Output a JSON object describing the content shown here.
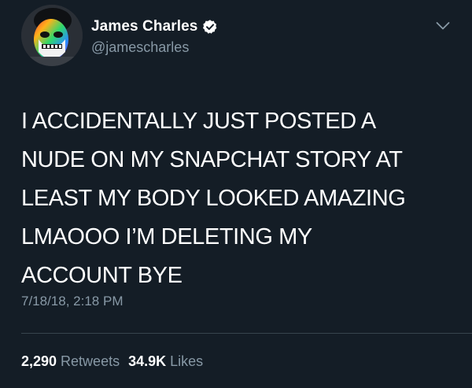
{
  "tweet": {
    "author": {
      "display_name": "James Charles",
      "handle": "@jamescharles",
      "verified": true,
      "avatar_icon": "profile-avatar"
    },
    "text_lines": [
      "I ACCIDENTALLY JUST POSTED A",
      "NUDE ON MY SNAPCHAT STORY AT",
      "LEAST MY BODY LOOKED AMAZING",
      "LMAOOO I’M DELETING MY",
      "ACCOUNT BYE"
    ],
    "timestamp": "7/18/18, 2:18 PM",
    "stats": {
      "retweets_count": "2,290",
      "retweets_label": "Retweets",
      "likes_count": "34.9K",
      "likes_label": "Likes"
    }
  },
  "colors": {
    "background": "#141d26",
    "primary_text": "#ffffff",
    "secondary_text": "#8899a6",
    "divider": "#38444d"
  },
  "icons": [
    "verified-badge-icon",
    "chevron-down-icon"
  ]
}
